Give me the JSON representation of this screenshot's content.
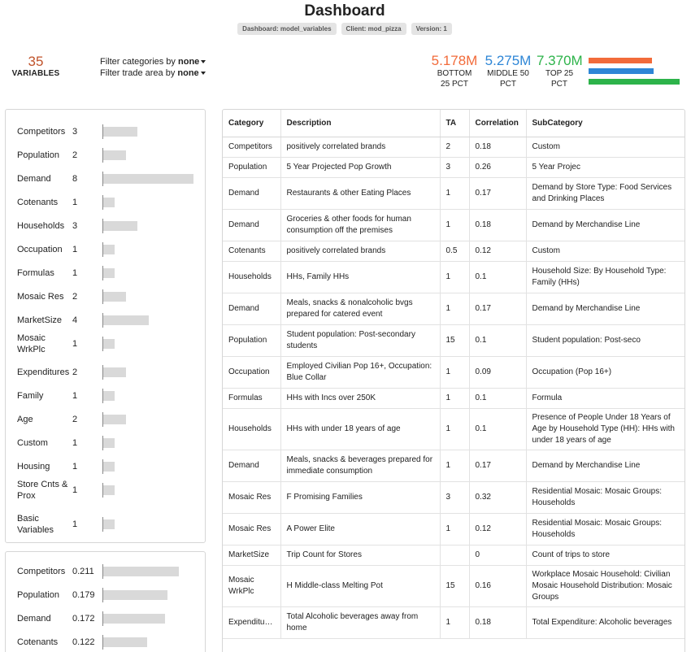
{
  "header": {
    "title": "Dashboard",
    "tags": [
      "Dashboard: model_variables",
      "Client: mod_pizza",
      "Version: 1"
    ]
  },
  "summary": {
    "count": "35",
    "count_label": "VARIABLES",
    "filter1_prefix": "Filter categories by",
    "filter1_value": "none",
    "filter2_prefix": "Filter trade area by",
    "filter2_value": "none"
  },
  "stats": [
    {
      "value": "5.178M",
      "label1": "BOTTOM",
      "label2": "25 PCT",
      "color": "#f26b3a",
      "fraction": 0.7
    },
    {
      "value": "5.275M",
      "label1": "MIDDLE 50",
      "label2": "PCT",
      "color": "#2e86d6",
      "fraction": 0.715
    },
    {
      "value": "7.370M",
      "label1": "TOP 25",
      "label2": "PCT",
      "color": "#2db34a",
      "fraction": 1.0
    }
  ],
  "category_counts": [
    {
      "label": "Competitors",
      "value": "3"
    },
    {
      "label": "Population",
      "value": "2"
    },
    {
      "label": "Demand",
      "value": "8"
    },
    {
      "label": "Cotenants",
      "value": "1"
    },
    {
      "label": "Households",
      "value": "3"
    },
    {
      "label": "Occupation",
      "value": "1"
    },
    {
      "label": "Formulas",
      "value": "1"
    },
    {
      "label": "Mosaic Res",
      "value": "2"
    },
    {
      "label": "MarketSize",
      "value": "4"
    },
    {
      "label": "Mosaic WrkPlc",
      "value": "1"
    },
    {
      "label": "Expenditures",
      "value": "2"
    },
    {
      "label": "Family",
      "value": "1"
    },
    {
      "label": "Age",
      "value": "2"
    },
    {
      "label": "Custom",
      "value": "1"
    },
    {
      "label": "Housing",
      "value": "1"
    },
    {
      "label": "Store Cnts & Prox",
      "value": "1"
    },
    {
      "label": "Basic Variables",
      "value": "1"
    }
  ],
  "category_correlations": [
    {
      "label": "Competitors",
      "value": "0.211"
    },
    {
      "label": "Population",
      "value": "0.179"
    },
    {
      "label": "Demand",
      "value": "0.172"
    },
    {
      "label": "Cotenants",
      "value": "0.122"
    }
  ],
  "table": {
    "columns": [
      "Category",
      "Description",
      "TA",
      "Correlation",
      "SubCategory"
    ],
    "rows": [
      [
        "Competitors",
        "positively correlated brands",
        "2",
        "0.18",
        "Custom"
      ],
      [
        "Population",
        "5 Year Projected Pop Growth",
        "3",
        "0.26",
        "5 Year Projec"
      ],
      [
        "Demand",
        "Restaurants & other Eating Places",
        "1",
        "0.17",
        "Demand by Store Type: Food Services and Drinking Places"
      ],
      [
        "Demand",
        "Groceries & other foods for human consumption off the premises",
        "1",
        "0.18",
        "Demand by Merchandise Line"
      ],
      [
        "Cotenants",
        "positively correlated brands",
        "0.5",
        "0.12",
        "Custom"
      ],
      [
        "Households",
        "HHs, Family HHs",
        "1",
        "0.1",
        "Household Size: By Household Type: Family (HHs)"
      ],
      [
        "Demand",
        "Meals, snacks & nonalcoholic bvgs prepared for catered event",
        "1",
        "0.17",
        "Demand by Merchandise Line"
      ],
      [
        "Population",
        "Student population: Post-secondary students",
        "15",
        "0.1",
        "Student population: Post-seco"
      ],
      [
        "Occupation",
        "Employed Civilian Pop 16+, Occupation: Blue Collar",
        "1",
        "0.09",
        "Occupation (Pop 16+)"
      ],
      [
        "Formulas",
        "HHs with Incs over 250K",
        "1",
        "0.1",
        "Formula"
      ],
      [
        "Households",
        "HHs with under 18 years of age",
        "1",
        "0.1",
        "Presence of People Under 18 Years of Age by Household Type (HH): HHs with under 18 years of age"
      ],
      [
        "Demand",
        "Meals, snacks & beverages prepared for immediate consumption",
        "1",
        "0.17",
        "Demand by Merchandise Line"
      ],
      [
        "Mosaic Res",
        "F Promising Families",
        "3",
        "0.32",
        "Residential Mosaic: Mosaic Groups: Households"
      ],
      [
        "Mosaic Res",
        "A Power Elite",
        "1",
        "0.12",
        "Residential Mosaic: Mosaic Groups: Households"
      ],
      [
        "MarketSize",
        "Trip Count for Stores",
        "",
        "0",
        "Count of trips to store"
      ],
      [
        "Mosaic WrkPlc",
        "H Middle-class Melting Pot",
        "15",
        "0.16",
        "Workplace Mosaic Household: Civilian Mosaic Household Distribution: Mosaic Groups"
      ],
      [
        "Expenditures",
        "Total Alcoholic beverages away from home",
        "1",
        "0.18",
        "Total Expenditure: Alcoholic beverages"
      ]
    ]
  }
}
